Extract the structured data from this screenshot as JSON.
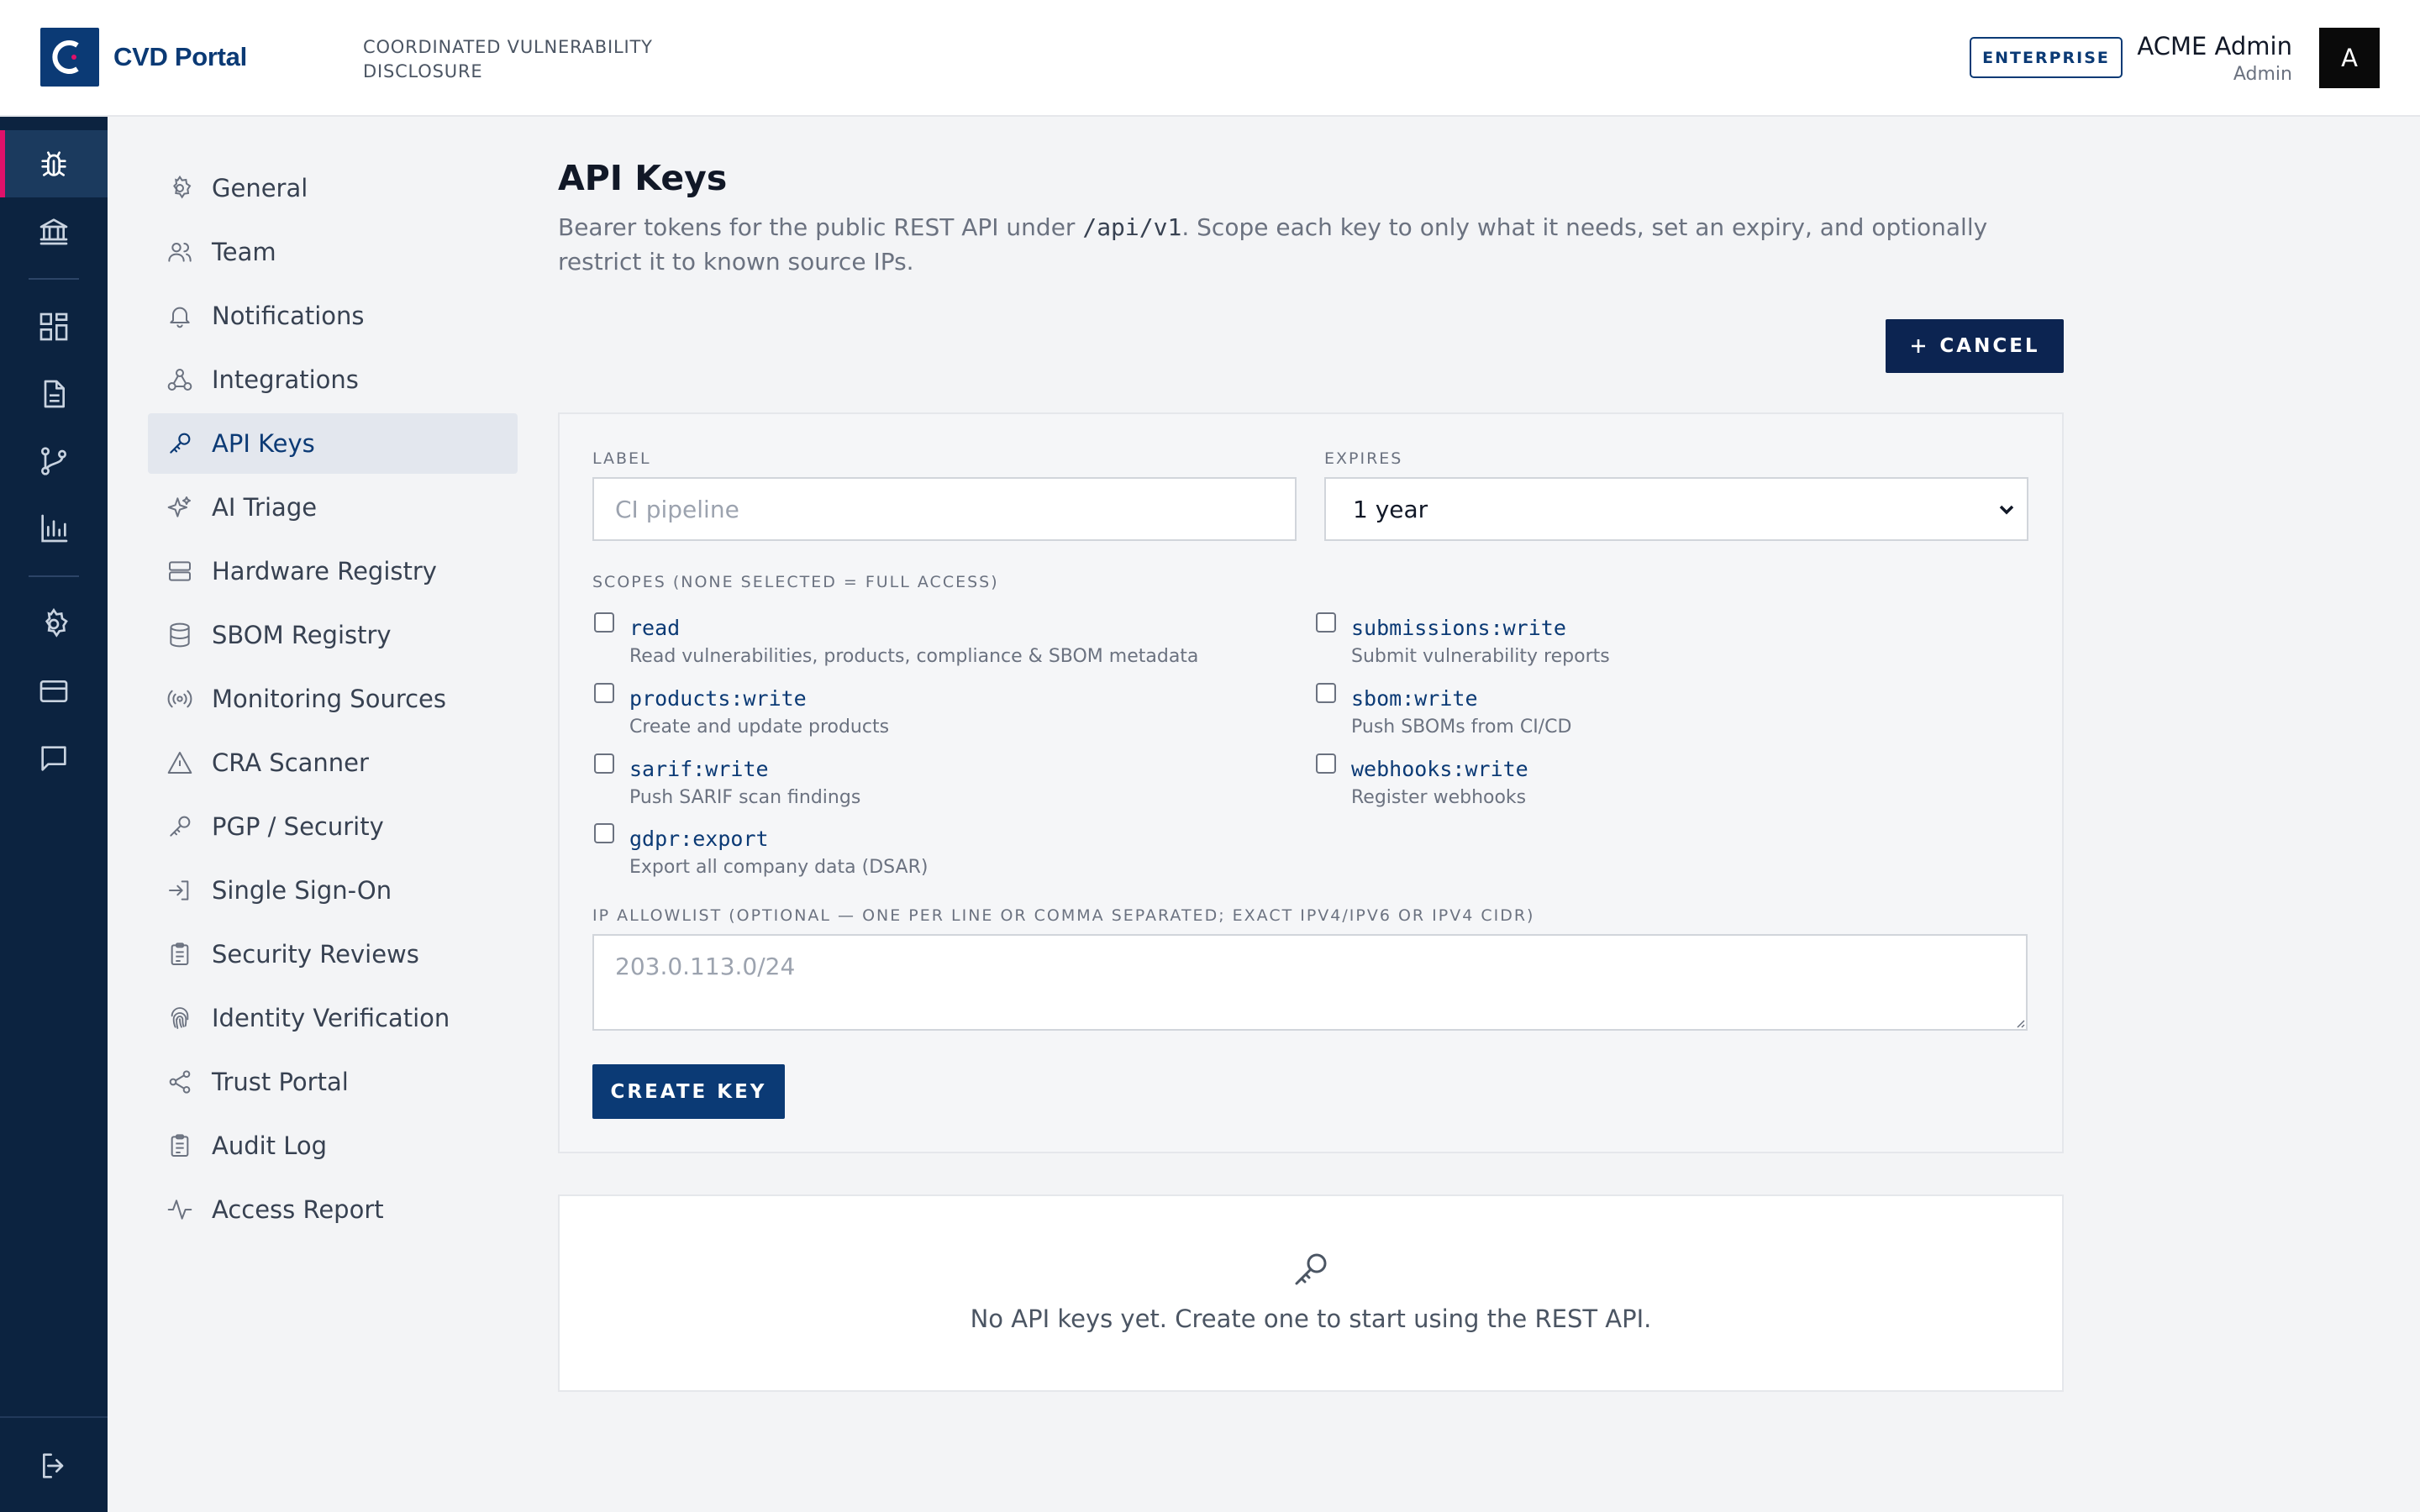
{
  "header": {
    "brand": "CVD Portal",
    "tagline": "COORDINATED VULNERABILITY DISCLOSURE",
    "plan_badge": "ENTERPRISE",
    "user_name": "ACME Admin",
    "user_role": "Admin",
    "avatar_initial": "A"
  },
  "rail": {
    "items": [
      {
        "icon": "bug-icon",
        "active": true
      },
      {
        "icon": "bank-icon"
      },
      {
        "icon": "dashboard-icon"
      },
      {
        "icon": "document-icon"
      },
      {
        "icon": "git-branch-icon"
      },
      {
        "icon": "bar-chart-icon"
      },
      {
        "icon": "gear-icon"
      },
      {
        "icon": "credit-card-icon"
      },
      {
        "icon": "chat-icon"
      },
      {
        "icon": "logout-icon"
      }
    ]
  },
  "settings_nav": {
    "items": [
      {
        "label": "General",
        "icon": "gear-icon"
      },
      {
        "label": "Team",
        "icon": "users-icon"
      },
      {
        "label": "Notifications",
        "icon": "bell-icon"
      },
      {
        "label": "Integrations",
        "icon": "webhook-icon"
      },
      {
        "label": "API Keys",
        "icon": "key-icon",
        "active": true
      },
      {
        "label": "AI Triage",
        "icon": "sparkles-icon"
      },
      {
        "label": "Hardware Registry",
        "icon": "server-icon"
      },
      {
        "label": "SBOM Registry",
        "icon": "database-icon"
      },
      {
        "label": "Monitoring Sources",
        "icon": "radio-icon"
      },
      {
        "label": "CRA Scanner",
        "icon": "warning-icon"
      },
      {
        "label": "PGP / Security",
        "icon": "key-icon"
      },
      {
        "label": "Single Sign-On",
        "icon": "login-icon"
      },
      {
        "label": "Security Reviews",
        "icon": "clipboard-icon"
      },
      {
        "label": "Identity Verification",
        "icon": "fingerprint-icon"
      },
      {
        "label": "Trust Portal",
        "icon": "share-icon"
      },
      {
        "label": "Audit Log",
        "icon": "clipboard-icon"
      },
      {
        "label": "Access Report",
        "icon": "activity-icon"
      }
    ]
  },
  "main": {
    "title": "API Keys",
    "description_before": "Bearer tokens for the public REST API under ",
    "description_code": "/api/v1",
    "description_after": ". Scope each key to only what it needs, set an expiry, and optionally restrict it to known source IPs.",
    "cancel_label": "CANCEL",
    "form": {
      "label_field": {
        "label": "LABEL",
        "placeholder": "CI pipeline",
        "value": ""
      },
      "expires_field": {
        "label": "EXPIRES",
        "value": "1 year"
      },
      "scopes_label": "SCOPES (NONE SELECTED = FULL ACCESS)",
      "scopes": [
        {
          "name": "read",
          "description": "Read vulnerabilities, products, compliance & SBOM metadata",
          "checked": false
        },
        {
          "name": "submissions:write",
          "description": "Submit vulnerability reports",
          "checked": false
        },
        {
          "name": "products:write",
          "description": "Create and update products",
          "checked": false
        },
        {
          "name": "sbom:write",
          "description": "Push SBOMs from CI/CD",
          "checked": false
        },
        {
          "name": "sarif:write",
          "description": "Push SARIF scan findings",
          "checked": false
        },
        {
          "name": "webhooks:write",
          "description": "Register webhooks",
          "checked": false
        },
        {
          "name": "gdpr:export",
          "description": "Export all company data (DSAR)",
          "checked": false
        }
      ],
      "ip_allowlist": {
        "label": "IP ALLOWLIST (OPTIONAL — ONE PER LINE OR COMMA SEPARATED; EXACT IPV4/IPV6 OR IPV4 CIDR)",
        "placeholder": "203.0.113.0/24",
        "value": ""
      },
      "create_label": "CREATE KEY"
    },
    "empty_state": "No API keys yet. Create one to start using the REST API."
  },
  "colors": {
    "brand": "#0b3a75",
    "rail_bg": "#0c2340",
    "active_indicator": "#e0116a",
    "page_bg": "#f3f4f6"
  }
}
